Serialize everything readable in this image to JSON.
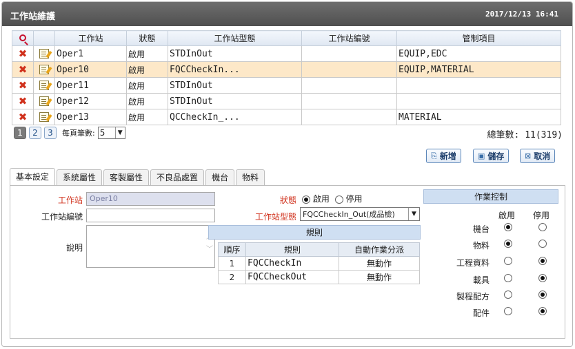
{
  "window": {
    "title": "工作站維護",
    "datetime": "2017/12/13 16:41"
  },
  "grid": {
    "headers": [
      "",
      "",
      "工作站",
      "狀態",
      "工作站型態",
      "工作站編號",
      "管制項目"
    ],
    "rows": [
      {
        "station": "Oper1",
        "status": "啟用",
        "type": "STDInOut",
        "code": "",
        "controls": "EQUIP,EDC"
      },
      {
        "station": "Oper10",
        "status": "啟用",
        "type": "FQCCheckIn...",
        "code": "",
        "controls": "EQUIP,MATERIAL"
      },
      {
        "station": "Oper11",
        "status": "啟用",
        "type": "STDInOut",
        "code": "",
        "controls": ""
      },
      {
        "station": "Oper12",
        "status": "啟用",
        "type": "STDInOut",
        "code": "",
        "controls": ""
      },
      {
        "station": "Oper13",
        "status": "啟用",
        "type": "QCCheckIn_...",
        "code": "",
        "controls": "MATERIAL"
      }
    ],
    "selected_row_index": 1
  },
  "pager": {
    "pages": [
      "1",
      "2",
      "3"
    ],
    "current": "1",
    "per_page_label": "每頁筆數:",
    "per_page_value": "5",
    "total": "總筆數: 11(319)"
  },
  "actions": {
    "add": "新增",
    "save": "儲存",
    "cancel": "取消"
  },
  "tabs": [
    "基本設定",
    "系統屬性",
    "客製屬性",
    "不良品處置",
    "機台",
    "物料"
  ],
  "form": {
    "station_label": "工作站",
    "station_value": "Oper10",
    "station_code_label": "工作站編號",
    "station_code_value": "",
    "desc_label": "說明",
    "desc_value": "",
    "status_label": "狀態",
    "status_on": "啟用",
    "status_off": "停用",
    "status_value": "啟用",
    "type_label": "工作站型態",
    "type_value": "FQCCheckIn_Out(成品檢)"
  },
  "rules": {
    "title": "規則",
    "headers": [
      "順序",
      "規則",
      "自動作業分派"
    ],
    "rows": [
      {
        "seq": "1",
        "rule": "FQCCheckIn",
        "auto": "無動作"
      },
      {
        "seq": "2",
        "rule": "FQCCheckOut",
        "auto": "無動作"
      }
    ]
  },
  "control": {
    "title": "作業控制",
    "col_on": "啟用",
    "col_off": "停用",
    "items": [
      {
        "name": "機台",
        "enabled": true
      },
      {
        "name": "物料",
        "enabled": true
      },
      {
        "name": "工程資料",
        "enabled": false
      },
      {
        "name": "載具",
        "enabled": false
      },
      {
        "name": "製程配方",
        "enabled": false
      },
      {
        "name": "配件",
        "enabled": false
      }
    ]
  }
}
